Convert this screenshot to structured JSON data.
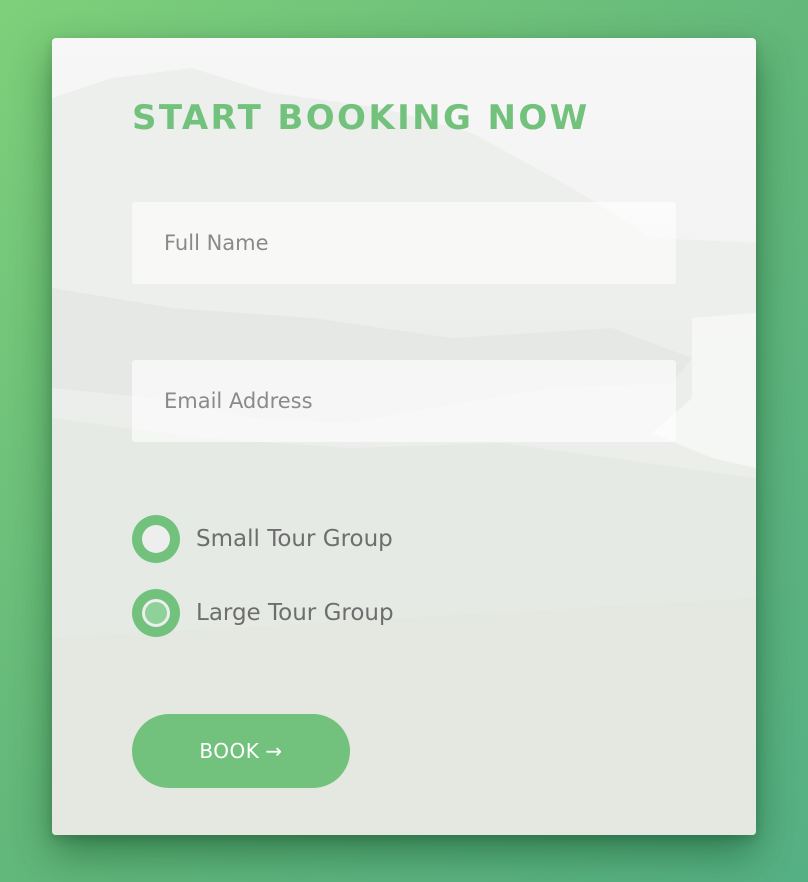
{
  "form": {
    "title": "START BOOKING NOW",
    "full_name": {
      "placeholder": "Full Name",
      "value": ""
    },
    "email": {
      "placeholder": "Email Address",
      "value": ""
    },
    "group_options": [
      {
        "label": "Small Tour Group",
        "checked": false
      },
      {
        "label": "Large Tour Group",
        "checked": true
      }
    ],
    "submit": {
      "label": "BOOK",
      "icon": "arrow-right-icon",
      "glyph": "→"
    }
  },
  "colors": {
    "accent": "#72c27e",
    "background_gradient_start": "#7ed07a",
    "background_gradient_end": "#55b084",
    "label_text": "#6e6e6e"
  }
}
